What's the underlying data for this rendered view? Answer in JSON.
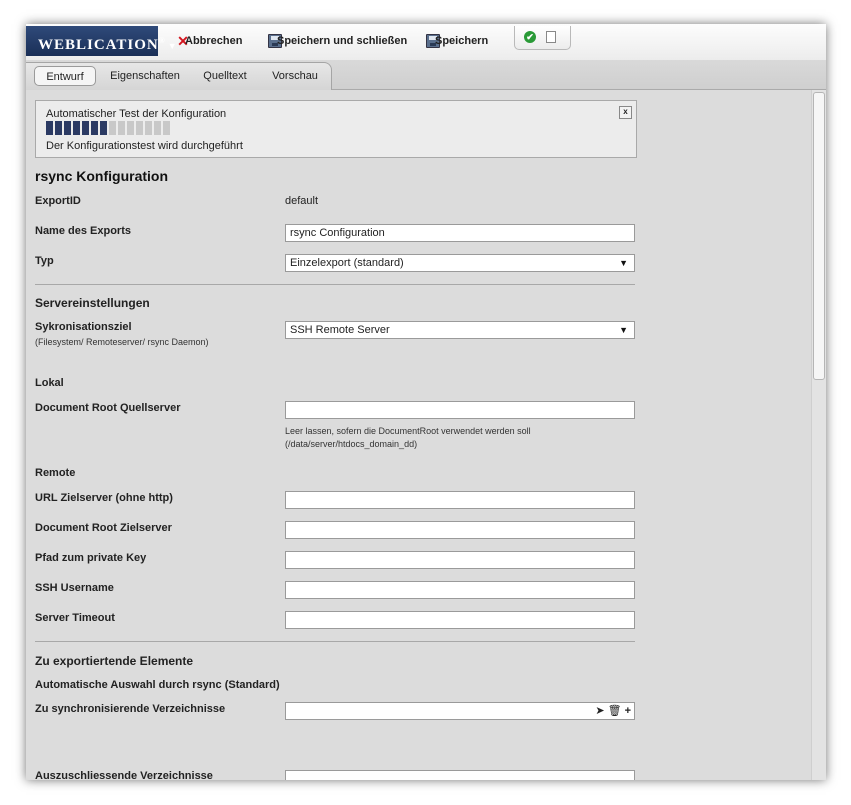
{
  "toolbar": {
    "logo": "WEBLICATION",
    "logo_mark": "®",
    "cancel": "Abbrechen",
    "save_close": "Speichern und schließen",
    "save": "Speichern",
    "icons": [
      "cancel-x-icon",
      "floppy-disk-icon",
      "check-circle-icon",
      "document-icon"
    ]
  },
  "tabs": [
    "Entwurf",
    "Eigenschaften",
    "Quelltext",
    "Vorschau"
  ],
  "test_box": {
    "title": "Automatischer Test der Konfiguration",
    "status": "Der Konfigurationstest wird durchgeführt",
    "close": "x",
    "progress": 0.5
  },
  "form": {
    "heading": "rsync Konfiguration",
    "export_id_label": "ExportID",
    "export_id_value": "default",
    "name_label": "Name des Exports",
    "name_value": "rsync Configuration",
    "type_label": "Typ",
    "type_value": "Einzelexport (standard)",
    "server_heading": "Servereinstellungen",
    "sync_label": "Sykronisationsziel",
    "sync_sub": "(Filesystem/ Remoteserver/ rsync Daemon)",
    "sync_value": "SSH Remote Server",
    "local_heading": "Lokal",
    "docroot_src_label": "Document Root Quellserver",
    "docroot_src_value": "",
    "docroot_hint": "Leer lassen, sofern die DocumentRoot verwendet werden soll (/data/server/htdocs_domain_dd)",
    "remote_heading": "Remote",
    "url_label": "URL Zielserver (ohne http)",
    "url_value": "",
    "docroot_dst_label": "Document Root Zielserver",
    "docroot_dst_value": "",
    "key_label": "Pfad zum private Key",
    "key_value": "",
    "ssh_user_label": "SSH Username",
    "ssh_user_value": "",
    "timeout_label": "Server Timeout",
    "timeout_value": "",
    "elements_heading": "Zu exportiertende Elemente",
    "auto_label": "Automatische Auswahl durch rsync (Standard)",
    "sync_dirs_label": "Zu synchronisierende Verzeichnisse",
    "exclude_dirs_label": "Auszuschliessende Verzeichnisse"
  }
}
